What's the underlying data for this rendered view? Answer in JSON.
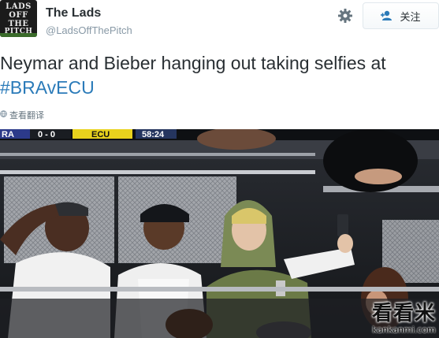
{
  "user": {
    "display_name": "The Lads",
    "handle": "@LadsOffThePitch",
    "avatar_logo": [
      "LADS",
      "OFF",
      "THE",
      "PITCH"
    ]
  },
  "follow": {
    "label": "关注",
    "icon": "add-user-icon"
  },
  "settings_icon": "gear-icon",
  "tweet": {
    "text_line1": "Neymar and Bieber hanging out taking selfies at",
    "hashtag": "#BRAvECU"
  },
  "translate": {
    "label": "查看翻译",
    "icon": "globe-icon"
  },
  "photo": {
    "scoreboard": {
      "left_team": "RA",
      "score": "0 - 0",
      "right_team": "ECU",
      "clock": "58:24"
    },
    "watermark_big": "看看米",
    "watermark_small": "kankanmi.com"
  },
  "colors": {
    "hashtag": "#2b7bb9",
    "text": "#292f33",
    "muted": "#8899a6",
    "scoreboard_yellow": "#e8d21d"
  }
}
